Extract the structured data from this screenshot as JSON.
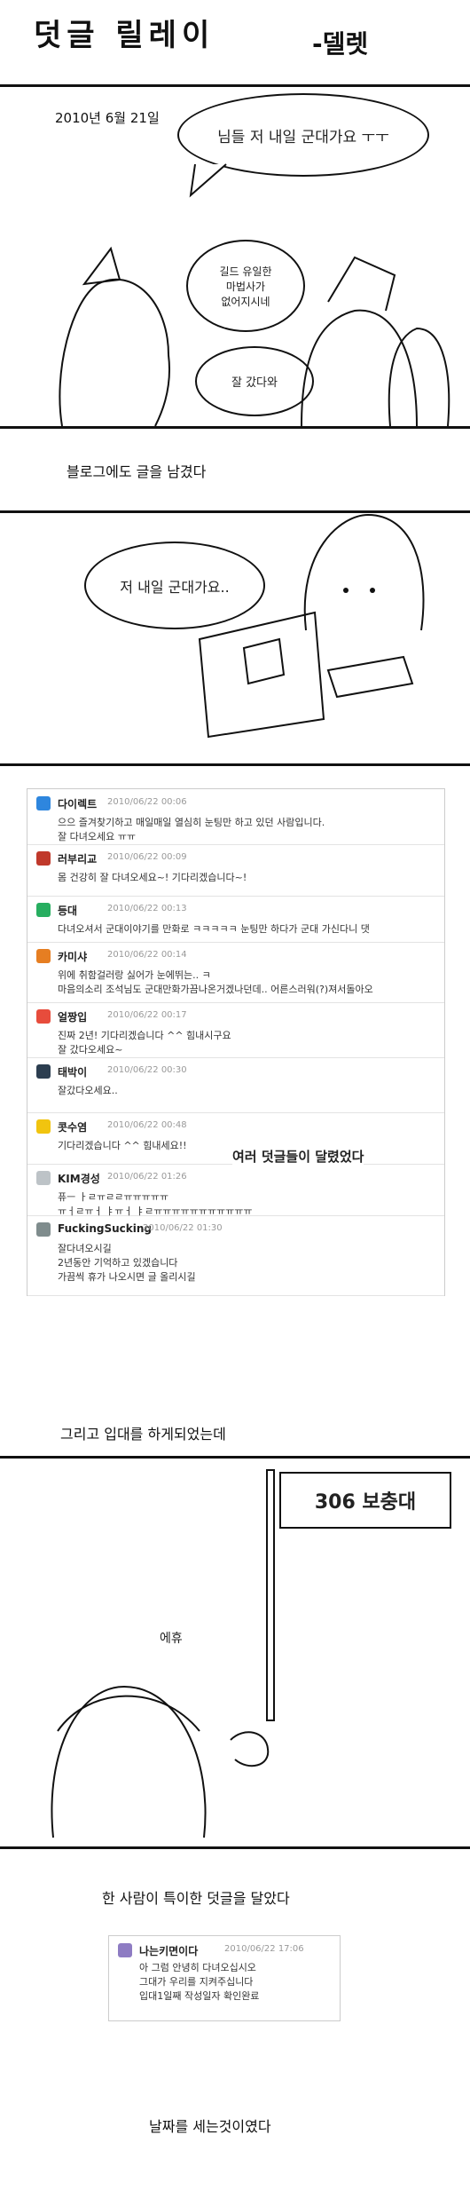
{
  "header": {
    "title": "덧글 릴레이",
    "author": "-델렛"
  },
  "panel1": {
    "date": "2010년 6월 21일",
    "bubble_main": "님들 저 내일 군대가요 ㅜㅜ",
    "bubble_guild": "길드 유일한\n마법사가\n없어지시네",
    "bubble_bye": "잘 갔다와"
  },
  "caption1": "블로그에도 글을 남겼다",
  "panel2": {
    "bubble": "저 내일 군대가요.."
  },
  "comments": [
    {
      "name": "다이렉트",
      "date": "2010/06/22 00:06",
      "text": "으으 즐겨찾기하고 매일매일 열심히 눈팅만 하고 있던 사람입니다.\n잘 다녀오세요 ㅠㅠ",
      "color": "#2e86de"
    },
    {
      "name": "러부리교",
      "date": "2010/06/22 00:09",
      "text": "몸 건강히 잘 다녀오세요~! 기다리겠습니다~!",
      "color": "#c0392b"
    },
    {
      "name": "등대",
      "date": "2010/06/22 00:13",
      "text": "다녀오셔서 군대이야기를 만화로 ㅋㅋㅋㅋㅋ 눈팅만 하다가 군대 가신다니 댓",
      "color": "#27ae60"
    },
    {
      "name": "카미샤",
      "date": "2010/06/22 00:14",
      "text": "위에 취함걸러랑 싫어가 눈에뛰는.. ㅋ\n마음의소리 조석님도 군대만화가끔나온거겠나던데.. 어른스러워(?)져서돌아오",
      "color": "#e67e22"
    },
    {
      "name": "얼짱입",
      "date": "2010/06/22 00:17",
      "text": "진짜 2년! 기다리겠습니다 ^^ 힘내시구요\n잘 갔다오세요~",
      "color": "#e74c3c"
    },
    {
      "name": "태박이",
      "date": "2010/06/22 00:30",
      "text": "잘갔다오세요..",
      "color": "#2c3e50"
    },
    {
      "name": "콧수염",
      "date": "2010/06/22 00:48",
      "text": "기다리겠습니다 ^^ 힘내세요!!",
      "color": "#f1c40f"
    },
    {
      "name": "KIM경성",
      "date": "2010/06/22 01:26",
      "text": "퓨ㅡ ㅏㄹㅠㄹㄹㅠㅠㅠㅠㅠ\nㅠㅓㄹㅠㅓ ㅑㅠㅓ ㅑㄹㅠㅠㅠㅠㅠㅠㅠㅠㅠㅠㅠ",
      "color": "#bdc3c7"
    },
    {
      "name": "FuckingSucking",
      "date": "2010/06/22 01:30",
      "text": "잘다녀오시길\n2년동안 기억하고 있겠습니다\n가끔씩 휴가 나오시면 글 올리시길",
      "color": "#7f8c8d"
    }
  ],
  "caption_comments": "여러 덧글들이 달렸었다",
  "caption2": "그리고 입대를 하게되었는데",
  "flag": "306 보충대",
  "sigh": "에휴",
  "caption3": "한 사람이 특이한 덧글을 달았다",
  "reply": {
    "name": "나는키면이다",
    "date": "2010/06/22 17:06",
    "text": "아 그럼 안녕히 다녀오십시오\n그대가 우리를 지켜주십니다\n입대1일째 작성일자 확인완료"
  },
  "caption4": "날짜를 세는것이였다"
}
